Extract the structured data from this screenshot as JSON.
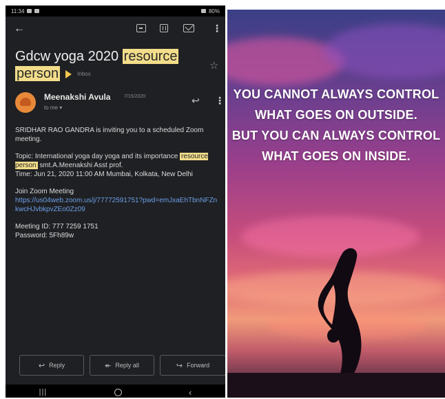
{
  "phone": {
    "status_bar": {
      "time": "11:34",
      "battery": "80%"
    },
    "subject": {
      "prefix": "Gdcw yoga 2020 ",
      "highlight_1": "resource",
      "highlight_2": "person",
      "label": "Inbox"
    },
    "sender": {
      "name": "Meenakshi Avula",
      "date": "7/15/2020",
      "to": "to me"
    },
    "body": {
      "intro": "SRIDHAR RAO GANDRA is inviting you to a scheduled Zoom meeting.",
      "topic_before": "Topic: International yoga day yoga and its importance ",
      "topic_highlight": "resource person",
      "topic_after": " smt.A.Meenakshi Asst prof.",
      "time": "Time: Jun 21, 2020 11:00 AM Mumbai, Kolkata, New Delhi",
      "join_label": "Join Zoom Meeting",
      "join_link": "https://us04web.zoom.us/j/77772591751?pwd=emJxaEhTbnNFZnkwcHJvbkpvZEo0Zz09",
      "meeting_id": "Meeting ID: 777 7259 1751",
      "password": "Password: 5Fh89w"
    },
    "actions": {
      "reply": "Reply",
      "reply_all": "Reply all",
      "forward": "Forward"
    },
    "colors": {
      "background": "#1f2023",
      "highlight": "#f3dd8a",
      "link": "#6b9fe8",
      "avatar": "#e8893a"
    },
    "icons": [
      "back-arrow-icon",
      "archive-icon",
      "delete-icon",
      "mail-icon",
      "more-icon",
      "star-icon",
      "reply-icon",
      "reply-all-icon",
      "forward-icon",
      "recents-icon",
      "home-icon",
      "back-nav-icon"
    ]
  },
  "poster": {
    "lines": [
      "YOU CANNOT ALWAYS CONTROL",
      "WHAT GOES ON OUTSIDE.",
      "BUT YOU CAN ALWAYS CONTROL",
      "WHAT GOES ON INSIDE."
    ]
  }
}
